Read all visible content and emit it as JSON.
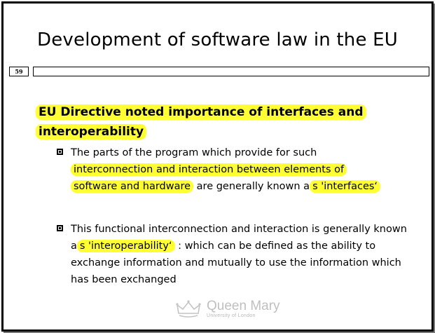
{
  "slide": {
    "title": "Development of software law in the EU",
    "number": "59"
  },
  "heading": {
    "line1": "EU Directive noted importance of interfaces and",
    "line2": "interoperability"
  },
  "bullets": [
    {
      "marker_icon": "square-bullet-icon",
      "parts": [
        "The parts of the program which provide for such",
        "interconnection and interaction between elements of",
        "software and hardware",
        " are generally known a",
        "s 'interfaces‘"
      ]
    },
    {
      "marker_icon": "square-bullet-icon",
      "parts": [
        "This functional interconnection and interaction is generally known a",
        "s 'interoperability‘",
        " : which can be defined as the ability to exchange information and mutually to use the information which has been exchanged"
      ]
    }
  ],
  "logo": {
    "name": "Queen Mary",
    "subtitle": "University of London",
    "icon": "crown-icon"
  },
  "colors": {
    "highlight": "#ffff33",
    "text": "#000000",
    "logo": "#c0c0c0"
  }
}
